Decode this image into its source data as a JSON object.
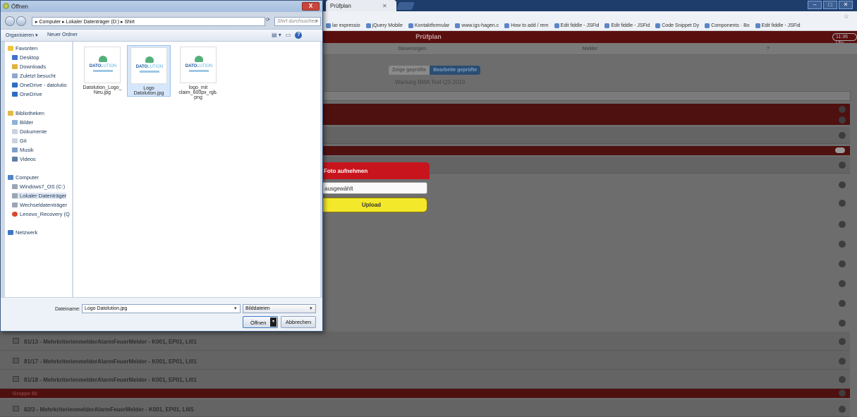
{
  "browser": {
    "tab_title": "Prüfplan",
    "bookmarks": [
      "lar expressio",
      "jQuery Mobile",
      "Kontaktformular",
      "www.igs-hagen.c",
      "How to add / rem",
      "Edit fiddle - JSFid",
      "Edit fiddle - JSFid",
      "Code Snippet Dy",
      "Components · Bo",
      "Edit fiddle - JSFid"
    ]
  },
  "app": {
    "header_title": "Prüfplan",
    "user_badge": "11:36 Uhr",
    "nav": [
      "Steuerungen",
      "Melder",
      "?"
    ],
    "toggle": [
      "Zeige geprüfte",
      "Bearbeite geprüfte"
    ],
    "test_name": "Wartung BMA Test Q3-2019",
    "rows": [
      "81/13 - MehrkriterienmelderAlarmFeuerMelder - K001, EP01, LI01",
      "81/17 - MehrkriterienmelderAlarmFeuerMelder - K001, EP01, LI01",
      "81/18 - MehrkriterienmelderAlarmFeuerMelder - K001, EP01, LI01",
      "82/3 - MehrkriterienmelderAlarmFeuerMelder - K001, EP01, LI65"
    ],
    "group_label": "Gruppe 82"
  },
  "popup": {
    "title": "Foto aufnehmen",
    "file_status": "ausgewählt",
    "upload_label": "Upload"
  },
  "dialog": {
    "title": "Öffnen",
    "close_label": "X",
    "breadcrumb": "▸ Computer ▸ Lokaler Datenträger (D:) ▸ Shirt",
    "search_placeholder": "Shirt durchsuchen",
    "organize_label": "Organisieren ▾",
    "new_folder_label": "Neuer Ordner",
    "nav": {
      "favorites": "Favoriten",
      "desktop": "Desktop",
      "downloads": "Downloads",
      "recent": "Zuletzt besucht",
      "onedrive1": "OneDrive - datolutio",
      "onedrive2": "OneDrive",
      "libraries": "Bibliotheken",
      "pictures": "Bilder",
      "documents": "Dokumente",
      "git": "Git",
      "music": "Musik",
      "videos": "Videos",
      "computer": "Computer",
      "drive_c": "Windows7_OS (C:)",
      "drive_d": "Lokaler Datenträger",
      "removable": "Wechseldatenträger",
      "recovery": "Lenovo_Recovery (Q",
      "network": "Netzwerk"
    },
    "files": [
      {
        "name": "Datolution_Logo_\nNeu.jpg",
        "selected": false
      },
      {
        "name": "Logo\nDatolution.jpg",
        "selected": true
      },
      {
        "name": "logo_mit\nclaim_600px_rgb.\npng",
        "selected": false
      }
    ],
    "logo_text_a": "DATO",
    "logo_text_b": "LUTION",
    "filename_label": "Dateiname:",
    "filename_value": "Logo Datolution.jpg",
    "filetype_value": "Bilddateien",
    "open_label": "Öffnen",
    "cancel_label": "Abbrechen"
  }
}
